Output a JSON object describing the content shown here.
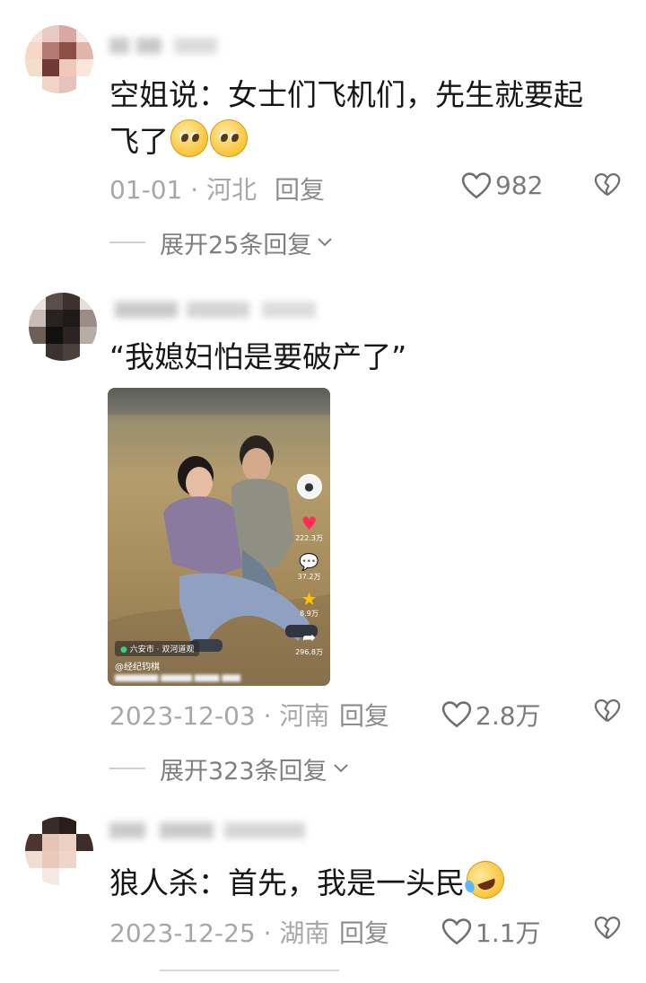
{
  "comments": [
    {
      "text": "空姐说：女士们飞机们，先生就要起飞了",
      "date": "01-01 · 河北",
      "reply_label": "回复",
      "likes": "982",
      "expand_label": "展开25条回复"
    },
    {
      "text": "“我媳妇怕是要破产了”",
      "date": "2023-12-03 · 河南",
      "reply_label": "回复",
      "likes": "2.8万",
      "expand_label": "展开323条回复",
      "video": {
        "location": "六安市 · 双河道观",
        "account": "@经纪钧棋",
        "side_likes": "222.3万",
        "side_comments": "37.2万",
        "side_favorites": "8.9万",
        "side_shares": "296.8万"
      }
    },
    {
      "text": "狼人杀：首先，我是一头民",
      "date": "2023-12-25 · 湖南",
      "reply_label": "回复",
      "likes": "1.1万"
    }
  ],
  "icons": {
    "like": "heart-outline-icon",
    "dislike": "broken-heart-icon",
    "expand": "chevron-down-icon",
    "location": "map-pin-icon"
  },
  "colors": {
    "text": "#161616",
    "meta": "#a7a7a7",
    "like_heart": "#6f6f6f",
    "video_like": "#ff2d55"
  }
}
